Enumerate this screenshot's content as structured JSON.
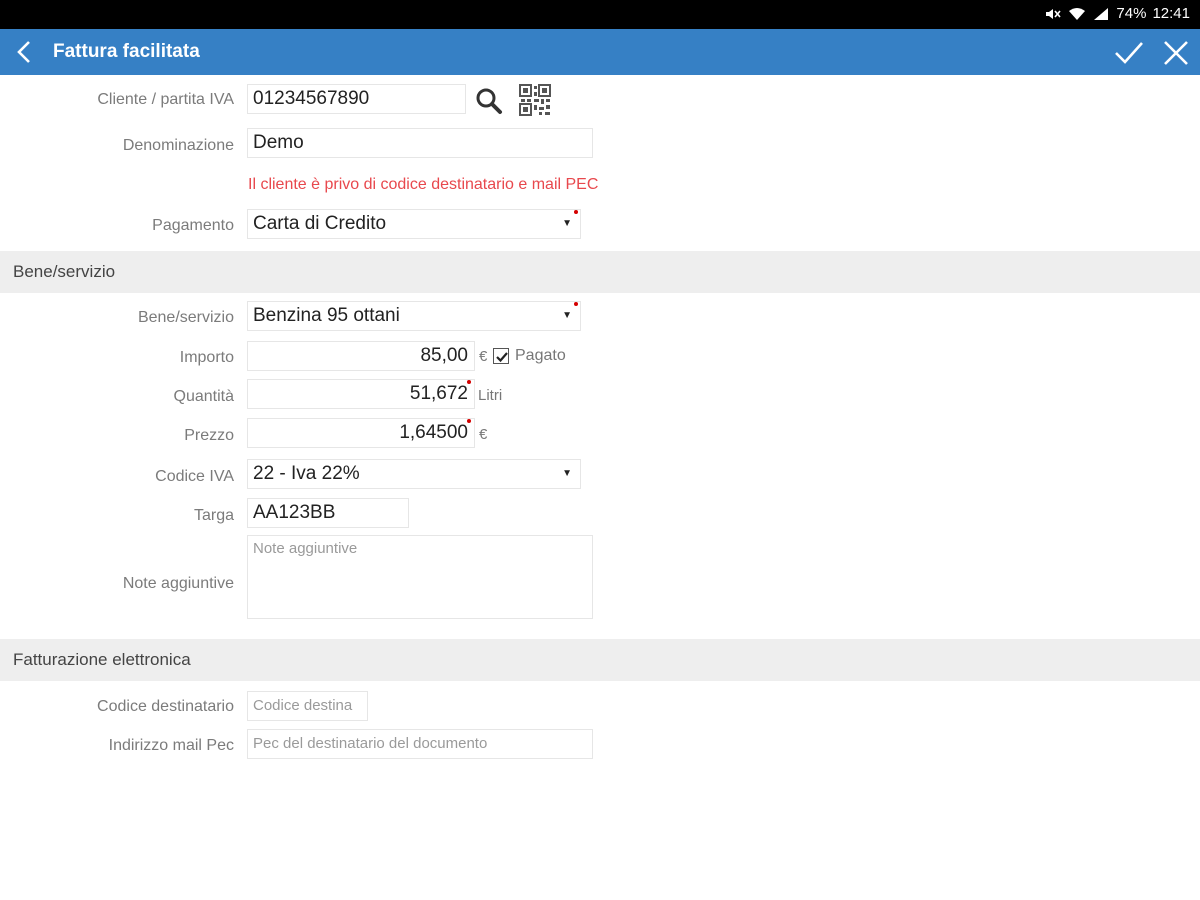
{
  "status": {
    "battery": "74%",
    "time": "12:41"
  },
  "header": {
    "title": "Fattura facilitata"
  },
  "client": {
    "vat_label": "Cliente / partita IVA",
    "vat_value": "01234567890",
    "name_label": "Denominazione",
    "name_value": "Demo",
    "warning": "Il cliente è privo di codice destinatario e mail PEC",
    "payment_label": "Pagamento",
    "payment_value": "Carta di Credito"
  },
  "goods": {
    "section_title": "Bene/servizio",
    "item_label": "Bene/servizio",
    "item_value": "Benzina 95 ottani",
    "amount_label": "Importo",
    "amount_value": "85,00",
    "amount_unit": "€",
    "paid_label": "Pagato",
    "paid_checked": true,
    "quantity_label": "Quantità",
    "quantity_value": "51,672",
    "quantity_unit": "Litri",
    "price_label": "Prezzo",
    "price_value": "1,64500",
    "price_unit": "€",
    "vat_code_label": "Codice IVA",
    "vat_code_value": "22 - Iva 22%",
    "plate_label": "Targa",
    "plate_value": "AA123BB",
    "notes_label": "Note aggiuntive",
    "notes_placeholder": "Note aggiuntive"
  },
  "einvoice": {
    "section_title": "Fatturazione elettronica",
    "recipient_code_label": "Codice destinatario",
    "recipient_code_placeholder": "Codice destina",
    "pec_label": "Indirizzo mail Pec",
    "pec_placeholder": "Pec del destinatario del documento"
  },
  "colors": {
    "accent": "#3680c5",
    "warning": "#e8484d",
    "required": "#d40000"
  },
  "icons": [
    "mute-icon",
    "wifi-icon",
    "signal-icon",
    "back-arrow-icon",
    "check-icon",
    "close-icon",
    "search-icon",
    "qr-code-icon",
    "dropdown-arrow-icon",
    "checkbox-checked-icon"
  ]
}
